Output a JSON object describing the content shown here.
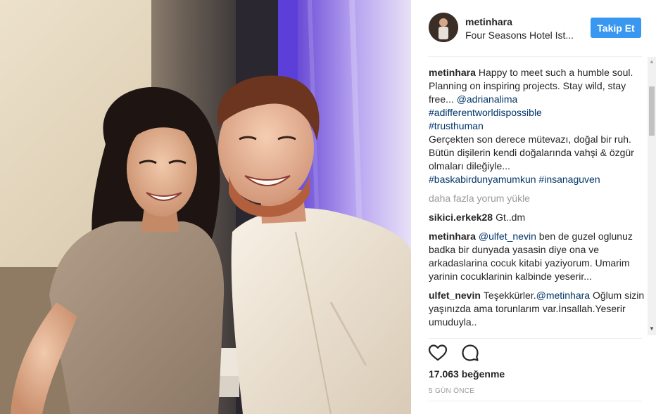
{
  "header": {
    "username": "metinhara",
    "location": "Four Seasons Hotel Ist...",
    "follow_label": "Takip Et"
  },
  "caption": {
    "user": "metinhara",
    "text": "Happy to meet such a humble soul. Planning on inspiring projects. Stay wild, stay free...",
    "mention": "@adrianalima",
    "tag1": "#adifferentworldispossible",
    "tag2": "#trusthuman",
    "text2": "Gerçekten son derece mütevazı, doğal bir ruh. Bütün dişilerin kendi doğalarında vahşi & özgür olmaları dileğiyle...",
    "tag3": "#baskabirdunyamumkun",
    "tag4": "#insanaguven"
  },
  "load_more": "daha fazla yorum yükle",
  "comments": [
    {
      "user": "sikici.erkek28",
      "text": "Gt..dm"
    },
    {
      "user": "metinhara",
      "mention": "@ulfet_nevin",
      "text": "ben de guzel oglunuz badka bir dunyada yasasin diye ona ve arkadaslarina cocuk kitabi yaziyorum. Umarim yarinin cocuklarinin kalbinde yeserir..."
    },
    {
      "user": "ulfet_nevin",
      "pre": "Teşekkürler.",
      "mention": "@metinhara",
      "text": "Oğlum sizin yaşınızda ama torunlarım var.İnsallah.Yeserir umuduyla.."
    }
  ],
  "likes": "17.063 beğenme",
  "time": "5 GÜN ÖNCE",
  "icons": {
    "like": "heart-icon",
    "comment": "comment-icon"
  },
  "colors": {
    "follow": "#3897f0",
    "link": "#003569",
    "muted": "#999999"
  }
}
